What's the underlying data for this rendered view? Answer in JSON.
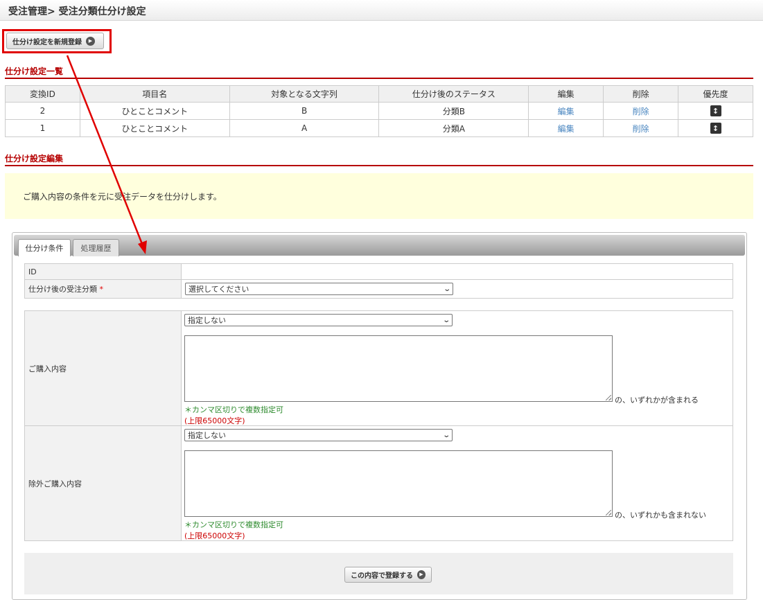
{
  "header": {
    "title": "受注管理> 受注分類仕分け設定"
  },
  "toolbar": {
    "new_label": "仕分け設定を新規登録"
  },
  "list_section": {
    "title": "仕分け設定一覧",
    "columns": [
      "変換ID",
      "項目名",
      "対象となる文字列",
      "仕分け後のステータス",
      "編集",
      "削除",
      "優先度"
    ],
    "rows": [
      {
        "id": "2",
        "item": "ひとことコメント",
        "target": "B",
        "status": "分類B",
        "edit": "編集",
        "delete": "削除"
      },
      {
        "id": "1",
        "item": "ひとことコメント",
        "target": "A",
        "status": "分類A",
        "edit": "編集",
        "delete": "削除"
      }
    ]
  },
  "edit_section": {
    "title": "仕分け設定編集",
    "info": "ご購入内容の条件を元に受注データを仕分けします。"
  },
  "tabs": [
    {
      "label": "仕分け条件",
      "active": true
    },
    {
      "label": "処理履歴",
      "active": false
    }
  ],
  "form": {
    "id_label": "ID",
    "id_value": "",
    "category_label": "仕分け後の受注分類",
    "required_mark": "*",
    "category_select": "選択してください",
    "purchase": {
      "label": "ご購入内容",
      "select": "指定しない",
      "suffix": "の、いずれかが含まれる",
      "note": "＊カンマ区切りで複数指定可",
      "limit": "(上限65000文字)"
    },
    "exclude": {
      "label": "除外ご購入内容",
      "select": "指定しない",
      "suffix": "の、いずれかも含まれない",
      "note": "＊カンマ区切りで複数指定可",
      "limit": "(上限65000文字)"
    }
  },
  "footer": {
    "submit_label": "この内容で登録する"
  },
  "colors": {
    "accent": "#b60000",
    "highlight": "#e00000",
    "link": "#4a86c0",
    "info_bg": "#ffffdd"
  }
}
